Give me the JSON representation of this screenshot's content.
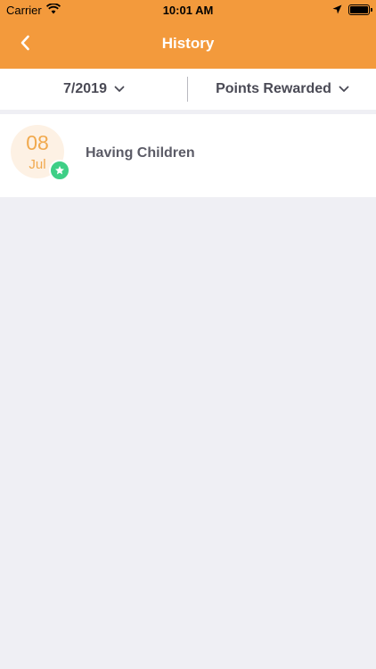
{
  "status_bar": {
    "carrier": "Carrier",
    "time": "10:01 AM",
    "icons": [
      "wifi-icon",
      "location-icon",
      "battery-icon"
    ]
  },
  "header": {
    "title": "History",
    "back_icon": "chevron-left-icon"
  },
  "filters": {
    "date_value": "7/2019",
    "type_value": "Points Rewarded",
    "dropdown_icon": "chevron-down-icon"
  },
  "history": {
    "items": [
      {
        "day": "08",
        "month": "Jul",
        "title": "Having Children",
        "badge_icon": "star-icon"
      }
    ]
  },
  "colors": {
    "accent": "#f39a3c",
    "background": "#efeff4",
    "badge": "#3ecf86",
    "date_text": "#f1a94d",
    "date_bg": "#fdf1e4"
  }
}
